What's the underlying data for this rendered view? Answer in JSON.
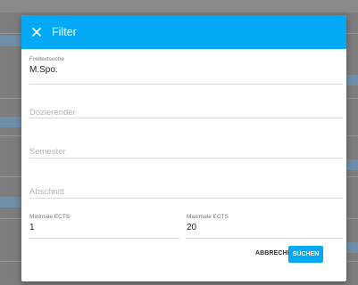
{
  "dialog": {
    "title": "Filter",
    "close_icon": "close-icon"
  },
  "fields": {
    "freitext": {
      "label": "Freitextsuche",
      "value": "M.Spo."
    },
    "dozierender": {
      "placeholder": "Dozierender"
    },
    "semester": {
      "placeholder": "Semester"
    },
    "abschnitt": {
      "placeholder": "Abschnitt"
    },
    "min_ects": {
      "label": "Minimale ECTS",
      "value": "1"
    },
    "max_ects": {
      "label": "Maximale ECTS",
      "value": "20"
    }
  },
  "actions": {
    "cancel_label": "ABBRECHEN",
    "search_label": "SUCHEN"
  },
  "colors": {
    "accent": "#03a9f4",
    "backdrop": "#7d7d7d"
  }
}
